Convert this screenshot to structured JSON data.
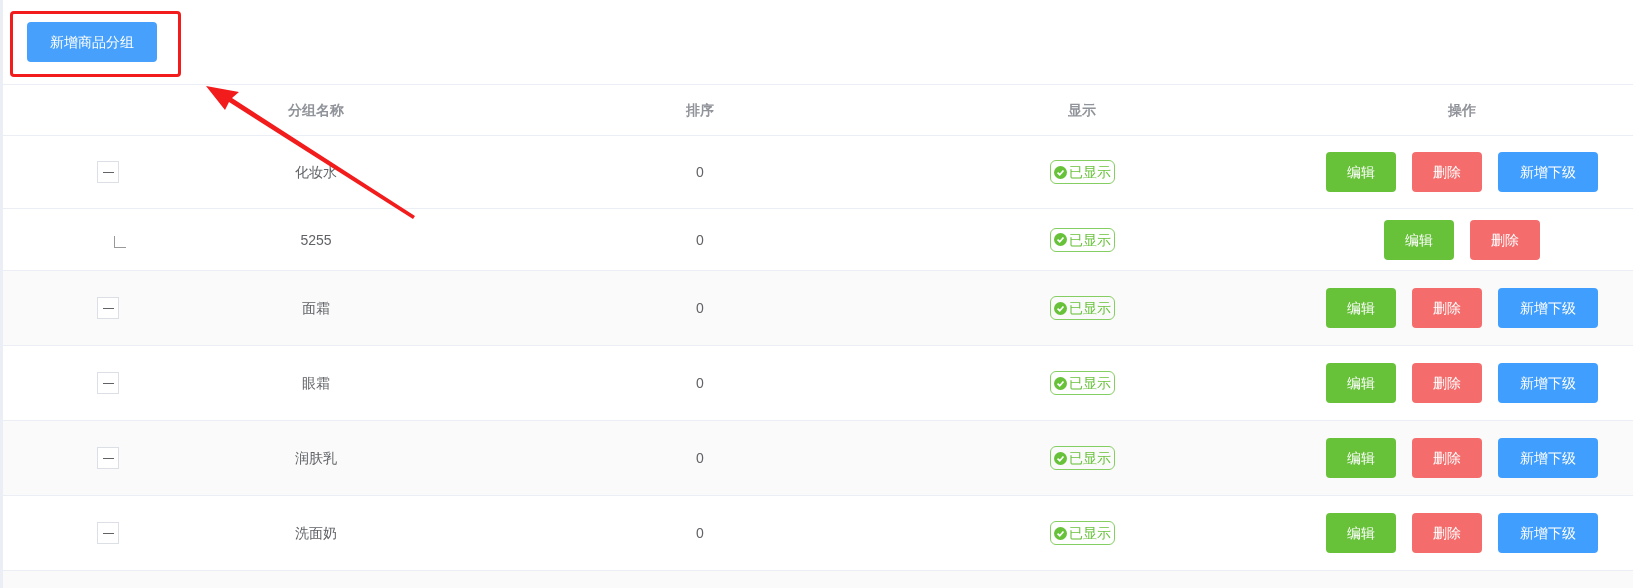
{
  "toolbar": {
    "add_button": "新增商品分组"
  },
  "table": {
    "columns": [
      "分组名称",
      "排序",
      "显示",
      "操作"
    ],
    "rows": [
      {
        "name": "化妆水",
        "sort": "0",
        "status": "已显示",
        "shown": true,
        "expanded": true,
        "actions": [
          {
            "kind": "edit",
            "label": "编辑"
          },
          {
            "kind": "delete",
            "label": "删除"
          },
          {
            "kind": "add-child",
            "label": "新增下级"
          }
        ],
        "children": [
          {
            "name": "5255",
            "sort": "0",
            "status": "已显示",
            "shown": true,
            "actions": [
              {
                "kind": "edit",
                "label": "编辑"
              },
              {
                "kind": "delete",
                "label": "删除"
              }
            ]
          }
        ]
      },
      {
        "name": "面霜",
        "sort": "0",
        "status": "已显示",
        "shown": true,
        "expanded": true,
        "actions": [
          {
            "kind": "edit",
            "label": "编辑"
          },
          {
            "kind": "delete",
            "label": "删除"
          },
          {
            "kind": "add-child",
            "label": "新增下级"
          }
        ]
      },
      {
        "name": "眼霜",
        "sort": "0",
        "status": "已显示",
        "shown": true,
        "expanded": true,
        "actions": [
          {
            "kind": "edit",
            "label": "编辑"
          },
          {
            "kind": "delete",
            "label": "删除"
          },
          {
            "kind": "add-child",
            "label": "新增下级"
          }
        ]
      },
      {
        "name": "润肤乳",
        "sort": "0",
        "status": "已显示",
        "shown": true,
        "expanded": true,
        "actions": [
          {
            "kind": "edit",
            "label": "编辑"
          },
          {
            "kind": "delete",
            "label": "删除"
          },
          {
            "kind": "add-child",
            "label": "新增下级"
          }
        ]
      },
      {
        "name": "洗面奶",
        "sort": "0",
        "status": "已显示",
        "shown": true,
        "expanded": true,
        "actions": [
          {
            "kind": "edit",
            "label": "编辑"
          },
          {
            "kind": "delete",
            "label": "删除"
          },
          {
            "kind": "add-child",
            "label": "新增下级"
          }
        ]
      }
    ]
  }
}
